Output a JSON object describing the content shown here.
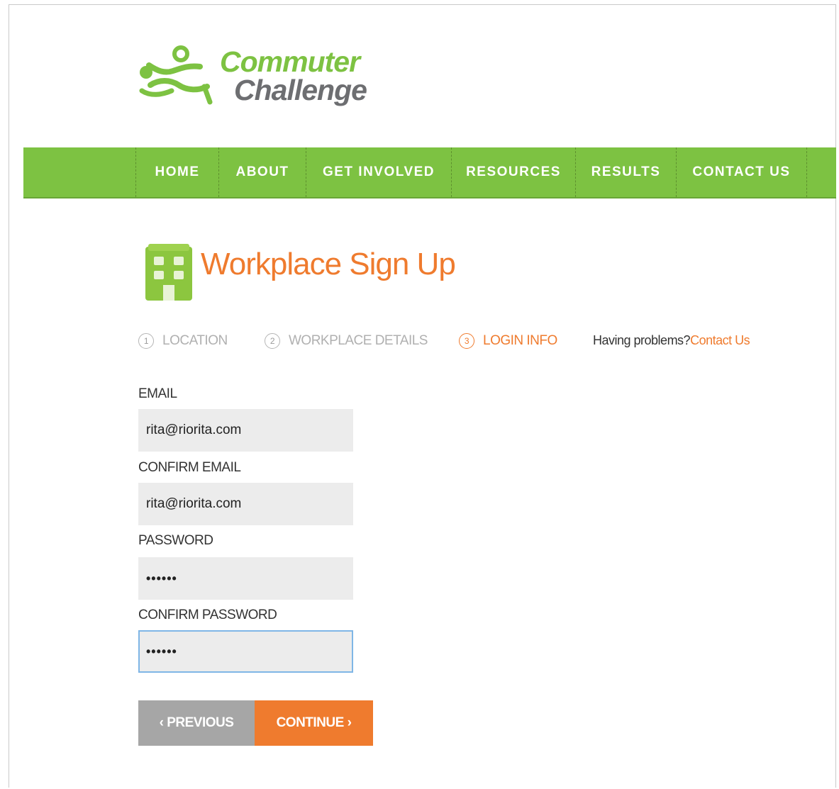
{
  "brand": {
    "line1": "Commuter",
    "line2": "Challenge",
    "green": "#7dc242",
    "gray": "#6d6e71",
    "accent": "#ef7b2e"
  },
  "nav": {
    "items": [
      {
        "label": "HOME"
      },
      {
        "label": "ABOUT"
      },
      {
        "label": "GET INVOLVED"
      },
      {
        "label": "RESOURCES"
      },
      {
        "label": "RESULTS"
      },
      {
        "label": "CONTACT US"
      }
    ]
  },
  "page": {
    "icon": "building-icon",
    "title": "Workplace Sign Up"
  },
  "steps": [
    {
      "num": "1",
      "label": "LOCATION",
      "state": "inactive"
    },
    {
      "num": "2",
      "label": "WORKPLACE DETAILS",
      "state": "inactive"
    },
    {
      "num": "3",
      "label": "LOGIN INFO",
      "state": "active"
    }
  ],
  "help": {
    "text": "Having problems?",
    "link": "Contact Us"
  },
  "form": {
    "email_label": "EMAIL",
    "email_value": "rita@riorita.com",
    "confirm_email_label": "CONFIRM EMAIL",
    "confirm_email_value": "rita@riorita.com",
    "password_label": "PASSWORD",
    "password_value": "••••••",
    "confirm_password_label": "CONFIRM PASSWORD",
    "confirm_password_value": "••••••"
  },
  "buttons": {
    "previous": "‹ PREVIOUS",
    "continue": "CONTINUE ›"
  }
}
